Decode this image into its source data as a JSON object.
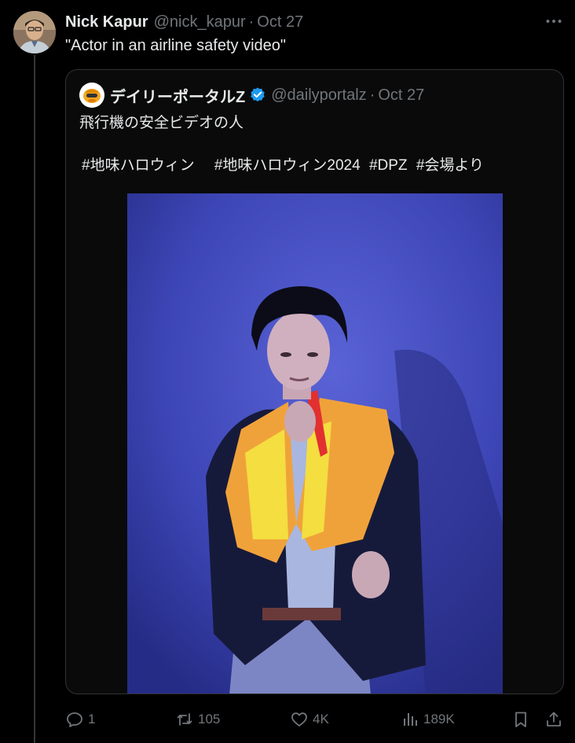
{
  "post": {
    "author_name": "Nick Kapur",
    "author_handle": "@nick_kapur",
    "separator": "·",
    "date": "Oct 27",
    "text": "\"Actor in an airline safety video\""
  },
  "quote": {
    "author_name": "デイリーポータルZ",
    "author_handle": "@dailyportalz",
    "separator": "·",
    "date": "Oct 27",
    "text": "飛行機の安全ビデオの人",
    "hashtags": [
      "#地味ハロウィン",
      "#地味ハロウィン2024",
      "#DPZ",
      "#会場より"
    ]
  },
  "actions": {
    "replies": "1",
    "reposts": "105",
    "likes": "4K",
    "views": "189K"
  },
  "colors": {
    "background": "#000000",
    "text": "#e7e9ea",
    "muted": "#71767b",
    "border": "#2f3336",
    "verified": "#1d9bf0"
  },
  "icons": [
    "more-icon",
    "verified-icon",
    "reply-icon",
    "repost-icon",
    "like-icon",
    "views-icon",
    "bookmark-icon",
    "share-icon"
  ]
}
